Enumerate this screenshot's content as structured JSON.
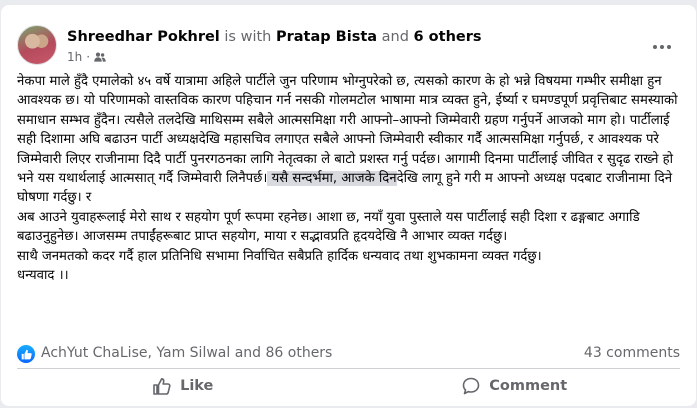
{
  "post": {
    "author": "Shreedhar Pokhrel",
    "with_text": "is with",
    "tagged": "Pratap Bista",
    "and_text": "and",
    "others": "6 others",
    "time": "1h",
    "audience_sep": "·",
    "audience_icon": "friends-icon",
    "paragraphs": [
      {
        "before": "नेकपा माले हुँदै एमालेको ४५ वर्षे यात्रामा अहिले पार्टीले जुन परिणाम भोग्नुपरेको छ, त्यसको कारण के हो भन्ने विषयमा गम्भीर समीक्षा हुन आवश्यक छ। यो परिणामको वास्तविक कारण पहिचान गर्न नसकी गोलमटोल भाषामा मात्र व्यक्त हुने, ईर्ष्या र घमण्डपूर्ण प्रवृत्तिबाट समस्याको समाधान सम्भव हुँदैन। त्यसैले तलदेखि माथिसम्म सबैले आत्मसमिक्षा गरी आफ्नो–आफ्नो जिम्मेवारी ग्रहण गर्नुपर्ने आजको माग हो। पार्टीलाई सही दिशामा अघि बढाउन पार्टी अध्यक्षदेखि महासचिव लगाएत सबैले आफ्नो जिम्मेवारी स्वीकार गर्दै आत्मसमिक्षा गर्नुपर्छ, र आवश्यक परे जिम्मेवारी लिएर राजीनामा दिदै पार्टी पुनरगठनका लागि नेतृत्वका ले बाटो प्रशस्त गर्नु पर्दछ। आगामी दिनमा पार्टीलाई जीवित र सुदृढ राख्ने हो भने यस यथार्थलाई आत्मसात् गर्दै जिम्मेवारी लिनैपर्छ।",
        "highlight": " यसै सन्दर्भमा, आजके दिन",
        "after": "देखि लागू हुने गरी म आफ्नो अध्यक्ष पदबाट राजीनामा दिने घोषणा गर्दछु। र"
      },
      {
        "before": "अब आउने युवाहरूलाई मेरो साथ र सहयोग पूर्ण रूपमा रहनेछ। आशा छ, नयाँ युवा पुस्ताले यस पार्टीलाई सही दिशा र ढङ्गबाट अगाडि बढाउनुहुनेछ। आजसम्म तपाईंहरूबाट प्राप्त सहयोग, माया र सद्भावप्रति हृदयदेखि नै आभार व्यक्त गर्दछु।",
        "highlight": "",
        "after": ""
      },
      {
        "before": "साथै जनमतको कदर गर्दै हाल प्रतिनिधि सभामा निर्वाचित सबैप्रति हार्दिक धन्यवाद तथा शुभकामना व्यक्त गर्दछु।",
        "highlight": "",
        "after": ""
      },
      {
        "before": "धन्यवाद ।।",
        "highlight": "",
        "after": ""
      }
    ]
  },
  "reactions": {
    "names": "AchYut ChaLise, Yam Silwal and 86 others",
    "comments": "43 comments",
    "icon": "like-reaction-icon",
    "color": "#0866ff"
  },
  "actions": {
    "like_label": "Like",
    "comment_label": "Comment"
  }
}
